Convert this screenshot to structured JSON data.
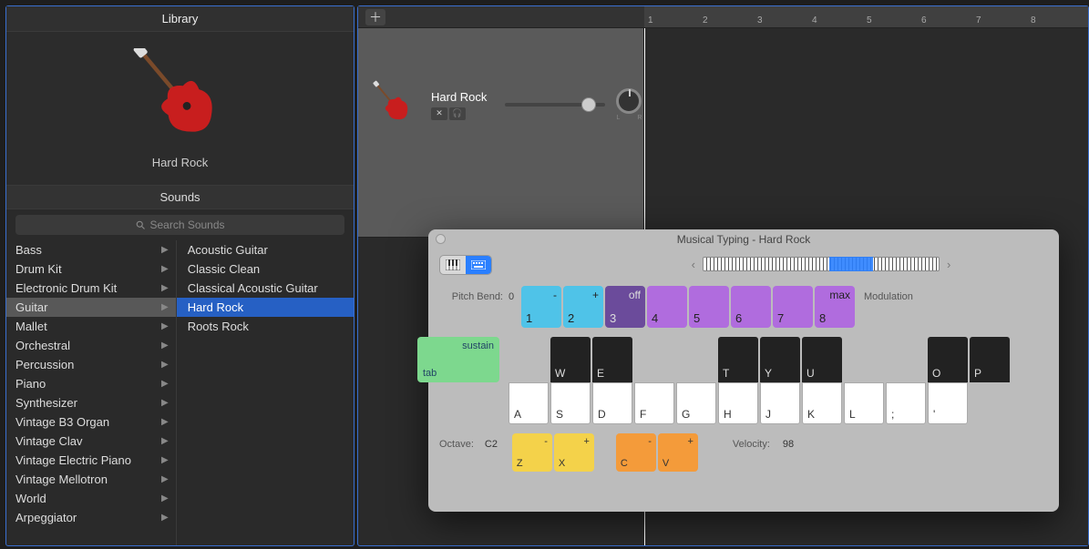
{
  "library": {
    "title": "Library",
    "preview_name": "Hard Rock",
    "sounds_header": "Sounds",
    "search_placeholder": "Search Sounds",
    "categories": [
      {
        "label": "Bass",
        "selected": false
      },
      {
        "label": "Drum Kit",
        "selected": false
      },
      {
        "label": "Electronic Drum Kit",
        "selected": false
      },
      {
        "label": "Guitar",
        "selected": true
      },
      {
        "label": "Mallet",
        "selected": false
      },
      {
        "label": "Orchestral",
        "selected": false
      },
      {
        "label": "Percussion",
        "selected": false
      },
      {
        "label": "Piano",
        "selected": false
      },
      {
        "label": "Synthesizer",
        "selected": false
      },
      {
        "label": "Vintage B3 Organ",
        "selected": false
      },
      {
        "label": "Vintage Clav",
        "selected": false
      },
      {
        "label": "Vintage Electric Piano",
        "selected": false
      },
      {
        "label": "Vintage Mellotron",
        "selected": false
      },
      {
        "label": "World",
        "selected": false
      },
      {
        "label": "Arpeggiator",
        "selected": false
      }
    ],
    "presets": [
      {
        "label": "Acoustic Guitar",
        "selected": false
      },
      {
        "label": "Classic Clean",
        "selected": false
      },
      {
        "label": "Classical Acoustic Guitar",
        "selected": false
      },
      {
        "label": "Hard Rock",
        "selected": true
      },
      {
        "label": "Roots Rock",
        "selected": false
      }
    ]
  },
  "timeline": {
    "numbers": [
      "1",
      "2",
      "3",
      "4",
      "5",
      "6",
      "7",
      "8"
    ]
  },
  "track": {
    "name": "Hard Rock",
    "pan_left": "L",
    "pan_right": "R"
  },
  "mt": {
    "title": "Musical Typing - Hard Rock",
    "pitch_bend_label": "Pitch Bend:",
    "pitch_bend_zero": "0",
    "modulation_label": "Modulation",
    "sustain_label": "sustain",
    "sustain_key": "tab",
    "octave_label": "Octave:",
    "octave_value": "C2",
    "velocity_label": "Velocity:",
    "velocity_value": "98",
    "pb_keys": [
      {
        "top": "-",
        "bot": "1",
        "bg": "#4fc3e8"
      },
      {
        "top": "+",
        "bot": "2",
        "bg": "#4fc3e8"
      },
      {
        "top": "off",
        "bot": "3",
        "bg": "#6b4b9b"
      },
      {
        "top": "",
        "bot": "4",
        "bg": "#b06cde"
      },
      {
        "top": "",
        "bot": "5",
        "bg": "#b06cde"
      },
      {
        "top": "",
        "bot": "6",
        "bg": "#b06cde"
      },
      {
        "top": "",
        "bot": "7",
        "bg": "#b06cde"
      },
      {
        "top": "max",
        "bot": "8",
        "bg": "#b06cde"
      }
    ],
    "black_keys": [
      "",
      "W",
      "E",
      "",
      "",
      "T",
      "Y",
      "U",
      "",
      "",
      "O",
      "P"
    ],
    "white_keys": [
      "A",
      "S",
      "D",
      "F",
      "G",
      "H",
      "J",
      "K",
      "L",
      ";",
      "'"
    ],
    "oct_keys": [
      {
        "top": "-",
        "bot": "Z",
        "bg": "#f4d24a"
      },
      {
        "top": "+",
        "bot": "X",
        "bg": "#f4d24a"
      }
    ],
    "vel_keys": [
      {
        "top": "-",
        "bot": "C",
        "bg": "#f49b3a"
      },
      {
        "top": "+",
        "bot": "V",
        "bg": "#f49b3a"
      }
    ]
  }
}
